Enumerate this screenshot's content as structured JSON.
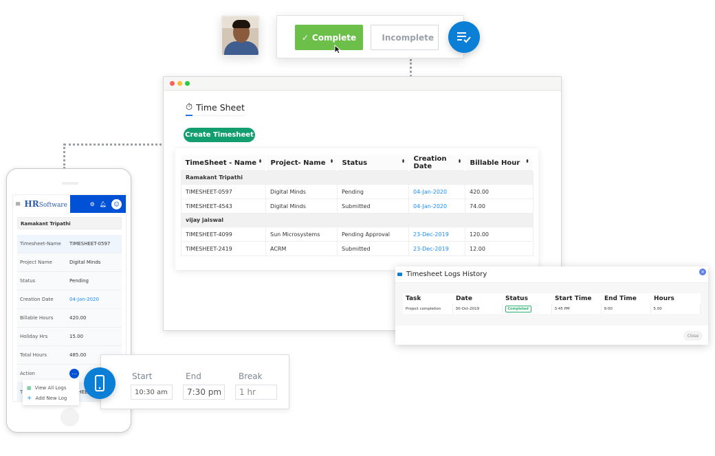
{
  "status_card": {
    "complete_label": "Complete",
    "incomplete_label": "Incomplete"
  },
  "window": {
    "title": "Time Sheet",
    "create_button": "Create Timesheet",
    "table": {
      "columns": [
        "TimeSheet - Name",
        "Project- Name",
        "Status",
        "Creation Date",
        "Billable Hour"
      ],
      "groups": [
        {
          "name": "Ramakant Tripathi",
          "rows": [
            [
              "TIMESHEET-0597",
              "Digital Minds",
              "Pending",
              "04-Jan-2020",
              "420.00"
            ],
            [
              "TIMESHEET-4543",
              "Digital Minds",
              "Submitted",
              "04-Jan-2020",
              "74.00"
            ]
          ]
        },
        {
          "name": "vijay jaiswal",
          "rows": [
            [
              "TIMESHEET-4099",
              "Sun Microsystems",
              "Pending Approval",
              "23-Dec-2019",
              "120.00"
            ],
            [
              "TIMESHEET-2419",
              "ACRM",
              "Submitted",
              "23-Dec-2019",
              "12.00"
            ]
          ]
        }
      ]
    }
  },
  "phone": {
    "logo_letters": "HR",
    "logo_text": "Software",
    "employee": "Ramakant Tripathi",
    "details": [
      {
        "label": "Timesheet-Name",
        "value": "TIMESHEET-0597"
      },
      {
        "label": "Project Name",
        "value": "Digital Minds"
      },
      {
        "label": "Status",
        "value": "Pending"
      },
      {
        "label": "Creation Date",
        "value": "04-Jan-2020"
      },
      {
        "label": "Billable Hours",
        "value": "420.00"
      },
      {
        "label": "Holiday Hrs",
        "value": "15.00"
      },
      {
        "label": "Total Hours",
        "value": "485.00"
      },
      {
        "label": "Action",
        "value": ""
      }
    ],
    "menu": [
      "View All Logs",
      "Add New Log"
    ],
    "partial_row": {
      "label": "Ti",
      "value": "SHEE"
    }
  },
  "times": {
    "start_label": "Start",
    "start_value": "10:30 am",
    "end_label": "End",
    "end_value": "7:30 pm",
    "break_label": "Break",
    "break_value": "1 hr"
  },
  "modal": {
    "title": "Timesheet Logs History",
    "columns": [
      "Task",
      "Date",
      "Status",
      "Start Time",
      "End Time",
      "Hours"
    ],
    "rows": [
      [
        "Project completion",
        "30-Oct-2019",
        "Completed",
        "3:45 PM",
        "9:00",
        "5.00"
      ]
    ],
    "close_label": "Close"
  },
  "colors": {
    "complete_green": "#6cc04a",
    "create_green": "#129e6e",
    "brand_blue": "#0b7fd6",
    "date_blue": "#1a8cff",
    "header_blue": "#0051d6"
  }
}
